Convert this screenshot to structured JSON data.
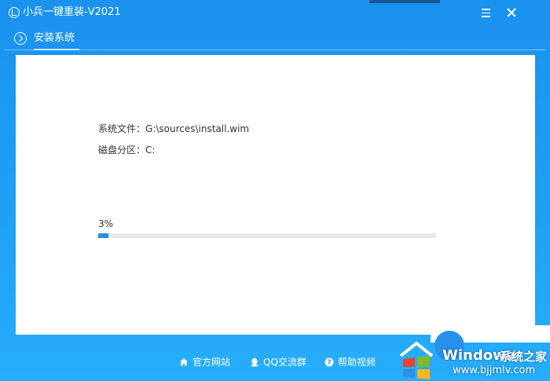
{
  "window": {
    "title": "小兵一键重装-V2021",
    "icons": {
      "logo": "app-logo-icon",
      "menu": "menu-icon",
      "close": "close-icon"
    }
  },
  "tabs": [
    {
      "label": "安装系统",
      "icon": "chevron-right-circle-icon",
      "active": true
    }
  ],
  "install": {
    "file_label": "系统文件：",
    "file_value": "G:\\sources\\install.wim",
    "disk_label": "磁盘分区：",
    "disk_value": "C:"
  },
  "progress": {
    "percent_text": "3%",
    "value": 0.03,
    "fill_color": "#2a8de3"
  },
  "footer": {
    "links": [
      {
        "label": "官方网站",
        "icon": "home-icon"
      },
      {
        "label": "QQ交流群",
        "icon": "qq-icon"
      },
      {
        "label": "帮助视频",
        "icon": "help-icon"
      }
    ]
  },
  "watermark": {
    "brand": "Windows",
    "brand_cn": "系统之家",
    "url": "www.bjjmlv.com"
  },
  "colors": {
    "accent": "#1a92ee",
    "content_bg": "#ffffff",
    "text": "#333333"
  }
}
